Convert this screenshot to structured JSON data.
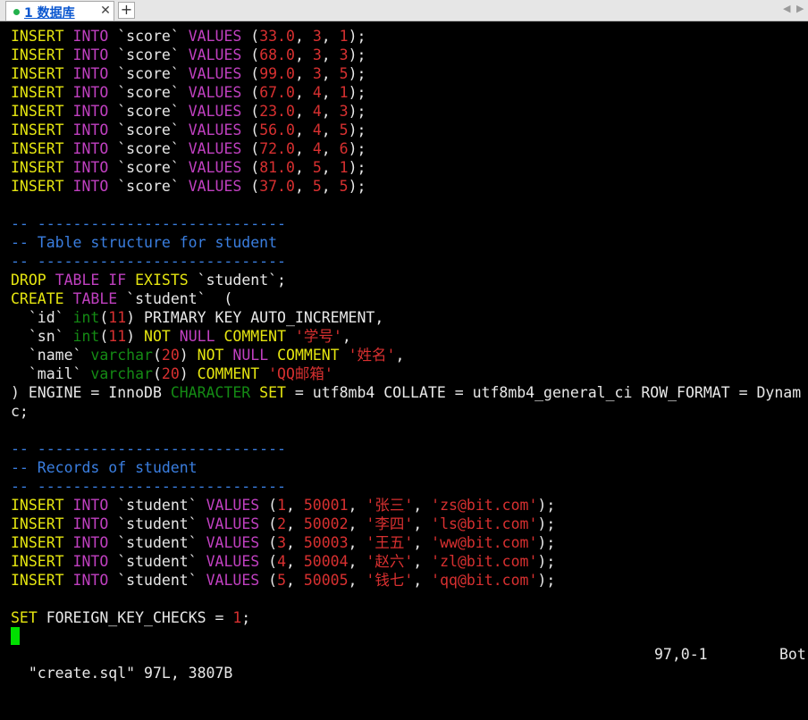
{
  "tab": {
    "label": "1 数据库",
    "close": "✕",
    "add": "+"
  },
  "nav": {
    "left": "◀",
    "right": "▶"
  },
  "colors": {
    "keyword": "#e5e510",
    "keyword_magenta": "#c040c0",
    "number_string": "#d83030",
    "type": "#148a14",
    "comment": "#3a7ee0",
    "text": "#e8e8e8",
    "background": "#000000",
    "cursor": "#00e000"
  },
  "lines": [
    [
      [
        "INSERT",
        "kw"
      ],
      [
        " ",
        ""
      ],
      [
        "INTO",
        "kw2"
      ],
      [
        " `score` ",
        ""
      ],
      [
        "VALUES",
        "kw2"
      ],
      [
        " (",
        ""
      ],
      [
        "33.0",
        "num"
      ],
      [
        ", ",
        ""
      ],
      [
        "3",
        "num"
      ],
      [
        ", ",
        ""
      ],
      [
        "1",
        "num"
      ],
      [
        ");",
        ""
      ]
    ],
    [
      [
        "INSERT",
        "kw"
      ],
      [
        " ",
        ""
      ],
      [
        "INTO",
        "kw2"
      ],
      [
        " `score` ",
        ""
      ],
      [
        "VALUES",
        "kw2"
      ],
      [
        " (",
        ""
      ],
      [
        "68.0",
        "num"
      ],
      [
        ", ",
        ""
      ],
      [
        "3",
        "num"
      ],
      [
        ", ",
        ""
      ],
      [
        "3",
        "num"
      ],
      [
        ");",
        ""
      ]
    ],
    [
      [
        "INSERT",
        "kw"
      ],
      [
        " ",
        ""
      ],
      [
        "INTO",
        "kw2"
      ],
      [
        " `score` ",
        ""
      ],
      [
        "VALUES",
        "kw2"
      ],
      [
        " (",
        ""
      ],
      [
        "99.0",
        "num"
      ],
      [
        ", ",
        ""
      ],
      [
        "3",
        "num"
      ],
      [
        ", ",
        ""
      ],
      [
        "5",
        "num"
      ],
      [
        ");",
        ""
      ]
    ],
    [
      [
        "INSERT",
        "kw"
      ],
      [
        " ",
        ""
      ],
      [
        "INTO",
        "kw2"
      ],
      [
        " `score` ",
        ""
      ],
      [
        "VALUES",
        "kw2"
      ],
      [
        " (",
        ""
      ],
      [
        "67.0",
        "num"
      ],
      [
        ", ",
        ""
      ],
      [
        "4",
        "num"
      ],
      [
        ", ",
        ""
      ],
      [
        "1",
        "num"
      ],
      [
        ");",
        ""
      ]
    ],
    [
      [
        "INSERT",
        "kw"
      ],
      [
        " ",
        ""
      ],
      [
        "INTO",
        "kw2"
      ],
      [
        " `score` ",
        ""
      ],
      [
        "VALUES",
        "kw2"
      ],
      [
        " (",
        ""
      ],
      [
        "23.0",
        "num"
      ],
      [
        ", ",
        ""
      ],
      [
        "4",
        "num"
      ],
      [
        ", ",
        ""
      ],
      [
        "3",
        "num"
      ],
      [
        ");",
        ""
      ]
    ],
    [
      [
        "INSERT",
        "kw"
      ],
      [
        " ",
        ""
      ],
      [
        "INTO",
        "kw2"
      ],
      [
        " `score` ",
        ""
      ],
      [
        "VALUES",
        "kw2"
      ],
      [
        " (",
        ""
      ],
      [
        "56.0",
        "num"
      ],
      [
        ", ",
        ""
      ],
      [
        "4",
        "num"
      ],
      [
        ", ",
        ""
      ],
      [
        "5",
        "num"
      ],
      [
        ");",
        ""
      ]
    ],
    [
      [
        "INSERT",
        "kw"
      ],
      [
        " ",
        ""
      ],
      [
        "INTO",
        "kw2"
      ],
      [
        " `score` ",
        ""
      ],
      [
        "VALUES",
        "kw2"
      ],
      [
        " (",
        ""
      ],
      [
        "72.0",
        "num"
      ],
      [
        ", ",
        ""
      ],
      [
        "4",
        "num"
      ],
      [
        ", ",
        ""
      ],
      [
        "6",
        "num"
      ],
      [
        ");",
        ""
      ]
    ],
    [
      [
        "INSERT",
        "kw"
      ],
      [
        " ",
        ""
      ],
      [
        "INTO",
        "kw2"
      ],
      [
        " `score` ",
        ""
      ],
      [
        "VALUES",
        "kw2"
      ],
      [
        " (",
        ""
      ],
      [
        "81.0",
        "num"
      ],
      [
        ", ",
        ""
      ],
      [
        "5",
        "num"
      ],
      [
        ", ",
        ""
      ],
      [
        "1",
        "num"
      ],
      [
        ");",
        ""
      ]
    ],
    [
      [
        "INSERT",
        "kw"
      ],
      [
        " ",
        ""
      ],
      [
        "INTO",
        "kw2"
      ],
      [
        " `score` ",
        ""
      ],
      [
        "VALUES",
        "kw2"
      ],
      [
        " (",
        ""
      ],
      [
        "37.0",
        "num"
      ],
      [
        ", ",
        ""
      ],
      [
        "5",
        "num"
      ],
      [
        ", ",
        ""
      ],
      [
        "5",
        "num"
      ],
      [
        ");",
        ""
      ]
    ],
    [],
    [
      [
        "-- ----------------------------",
        "cm"
      ]
    ],
    [
      [
        "-- Table structure for student",
        "cm"
      ]
    ],
    [
      [
        "-- ----------------------------",
        "cm"
      ]
    ],
    [
      [
        "DROP",
        "kw"
      ],
      [
        " ",
        ""
      ],
      [
        "TABLE",
        "kw2"
      ],
      [
        " ",
        ""
      ],
      [
        "IF",
        "kw2"
      ],
      [
        " ",
        ""
      ],
      [
        "EXISTS",
        "kw"
      ],
      [
        " `student`;",
        ""
      ]
    ],
    [
      [
        "CREATE",
        "kw"
      ],
      [
        " ",
        ""
      ],
      [
        "TABLE",
        "kw2"
      ],
      [
        " `student`  (",
        ""
      ]
    ],
    [
      [
        "  `id` ",
        ""
      ],
      [
        "int",
        "ty"
      ],
      [
        "(",
        ""
      ],
      [
        "11",
        "num"
      ],
      [
        ") PRIMARY KEY AUTO_INCREMENT,",
        ""
      ]
    ],
    [
      [
        "  `sn` ",
        ""
      ],
      [
        "int",
        "ty"
      ],
      [
        "(",
        ""
      ],
      [
        "11",
        "num"
      ],
      [
        ") ",
        ""
      ],
      [
        "NOT",
        "kw"
      ],
      [
        " ",
        ""
      ],
      [
        "NULL",
        "kw2"
      ],
      [
        " ",
        ""
      ],
      [
        "COMMENT",
        "kw"
      ],
      [
        " ",
        ""
      ],
      [
        "'学号'",
        "str"
      ],
      [
        ",",
        ""
      ]
    ],
    [
      [
        "  `name` ",
        ""
      ],
      [
        "varchar",
        "ty"
      ],
      [
        "(",
        ""
      ],
      [
        "20",
        "num"
      ],
      [
        ") ",
        ""
      ],
      [
        "NOT",
        "kw"
      ],
      [
        " ",
        ""
      ],
      [
        "NULL",
        "kw2"
      ],
      [
        " ",
        ""
      ],
      [
        "COMMENT",
        "kw"
      ],
      [
        " ",
        ""
      ],
      [
        "'姓名'",
        "str"
      ],
      [
        ",",
        ""
      ]
    ],
    [
      [
        "  `mail` ",
        ""
      ],
      [
        "varchar",
        "ty"
      ],
      [
        "(",
        ""
      ],
      [
        "20",
        "num"
      ],
      [
        ") ",
        ""
      ],
      [
        "COMMENT",
        "kw"
      ],
      [
        " ",
        ""
      ],
      [
        "'QQ邮箱'",
        "str"
      ]
    ],
    [
      [
        ") ENGINE = InnoDB ",
        ""
      ],
      [
        "CHARACTER",
        "ty"
      ],
      [
        " ",
        ""
      ],
      [
        "SET",
        "kw"
      ],
      [
        " = utf8mb4 COLLATE = utf8mb4_general_ci ROW_FORMAT = Dynam",
        ""
      ]
    ],
    [
      [
        "c;",
        ""
      ]
    ],
    [],
    [
      [
        "-- ----------------------------",
        "cm"
      ]
    ],
    [
      [
        "-- Records of student",
        "cm"
      ]
    ],
    [
      [
        "-- ----------------------------",
        "cm"
      ]
    ],
    [
      [
        "INSERT",
        "kw"
      ],
      [
        " ",
        ""
      ],
      [
        "INTO",
        "kw2"
      ],
      [
        " `student` ",
        ""
      ],
      [
        "VALUES",
        "kw2"
      ],
      [
        " (",
        ""
      ],
      [
        "1",
        "num"
      ],
      [
        ", ",
        ""
      ],
      [
        "50001",
        "num"
      ],
      [
        ", ",
        ""
      ],
      [
        "'张三'",
        "str"
      ],
      [
        ", ",
        ""
      ],
      [
        "'zs@bit.com'",
        "str"
      ],
      [
        ");",
        ""
      ]
    ],
    [
      [
        "INSERT",
        "kw"
      ],
      [
        " ",
        ""
      ],
      [
        "INTO",
        "kw2"
      ],
      [
        " `student` ",
        ""
      ],
      [
        "VALUES",
        "kw2"
      ],
      [
        " (",
        ""
      ],
      [
        "2",
        "num"
      ],
      [
        ", ",
        ""
      ],
      [
        "50002",
        "num"
      ],
      [
        ", ",
        ""
      ],
      [
        "'李四'",
        "str"
      ],
      [
        ", ",
        ""
      ],
      [
        "'ls@bit.com'",
        "str"
      ],
      [
        ");",
        ""
      ]
    ],
    [
      [
        "INSERT",
        "kw"
      ],
      [
        " ",
        ""
      ],
      [
        "INTO",
        "kw2"
      ],
      [
        " `student` ",
        ""
      ],
      [
        "VALUES",
        "kw2"
      ],
      [
        " (",
        ""
      ],
      [
        "3",
        "num"
      ],
      [
        ", ",
        ""
      ],
      [
        "50003",
        "num"
      ],
      [
        ", ",
        ""
      ],
      [
        "'王五'",
        "str"
      ],
      [
        ", ",
        ""
      ],
      [
        "'ww@bit.com'",
        "str"
      ],
      [
        ");",
        ""
      ]
    ],
    [
      [
        "INSERT",
        "kw"
      ],
      [
        " ",
        ""
      ],
      [
        "INTO",
        "kw2"
      ],
      [
        " `student` ",
        ""
      ],
      [
        "VALUES",
        "kw2"
      ],
      [
        " (",
        ""
      ],
      [
        "4",
        "num"
      ],
      [
        ", ",
        ""
      ],
      [
        "50004",
        "num"
      ],
      [
        ", ",
        ""
      ],
      [
        "'赵六'",
        "str"
      ],
      [
        ", ",
        ""
      ],
      [
        "'zl@bit.com'",
        "str"
      ],
      [
        ");",
        ""
      ]
    ],
    [
      [
        "INSERT",
        "kw"
      ],
      [
        " ",
        ""
      ],
      [
        "INTO",
        "kw2"
      ],
      [
        " `student` ",
        ""
      ],
      [
        "VALUES",
        "kw2"
      ],
      [
        " (",
        ""
      ],
      [
        "5",
        "num"
      ],
      [
        ", ",
        ""
      ],
      [
        "50005",
        "num"
      ],
      [
        ", ",
        ""
      ],
      [
        "'钱七'",
        "str"
      ],
      [
        ", ",
        ""
      ],
      [
        "'qq@bit.com'",
        "str"
      ],
      [
        ");",
        ""
      ]
    ],
    [],
    [
      [
        "SET",
        "kw"
      ],
      [
        " FOREIGN_KEY_CHECKS = ",
        ""
      ],
      [
        "1",
        "num"
      ],
      [
        ";",
        ""
      ]
    ]
  ],
  "status": {
    "file_info": "\"create.sql\" 97L, 3807B",
    "position": "97,0-1",
    "percent": "Bot"
  }
}
